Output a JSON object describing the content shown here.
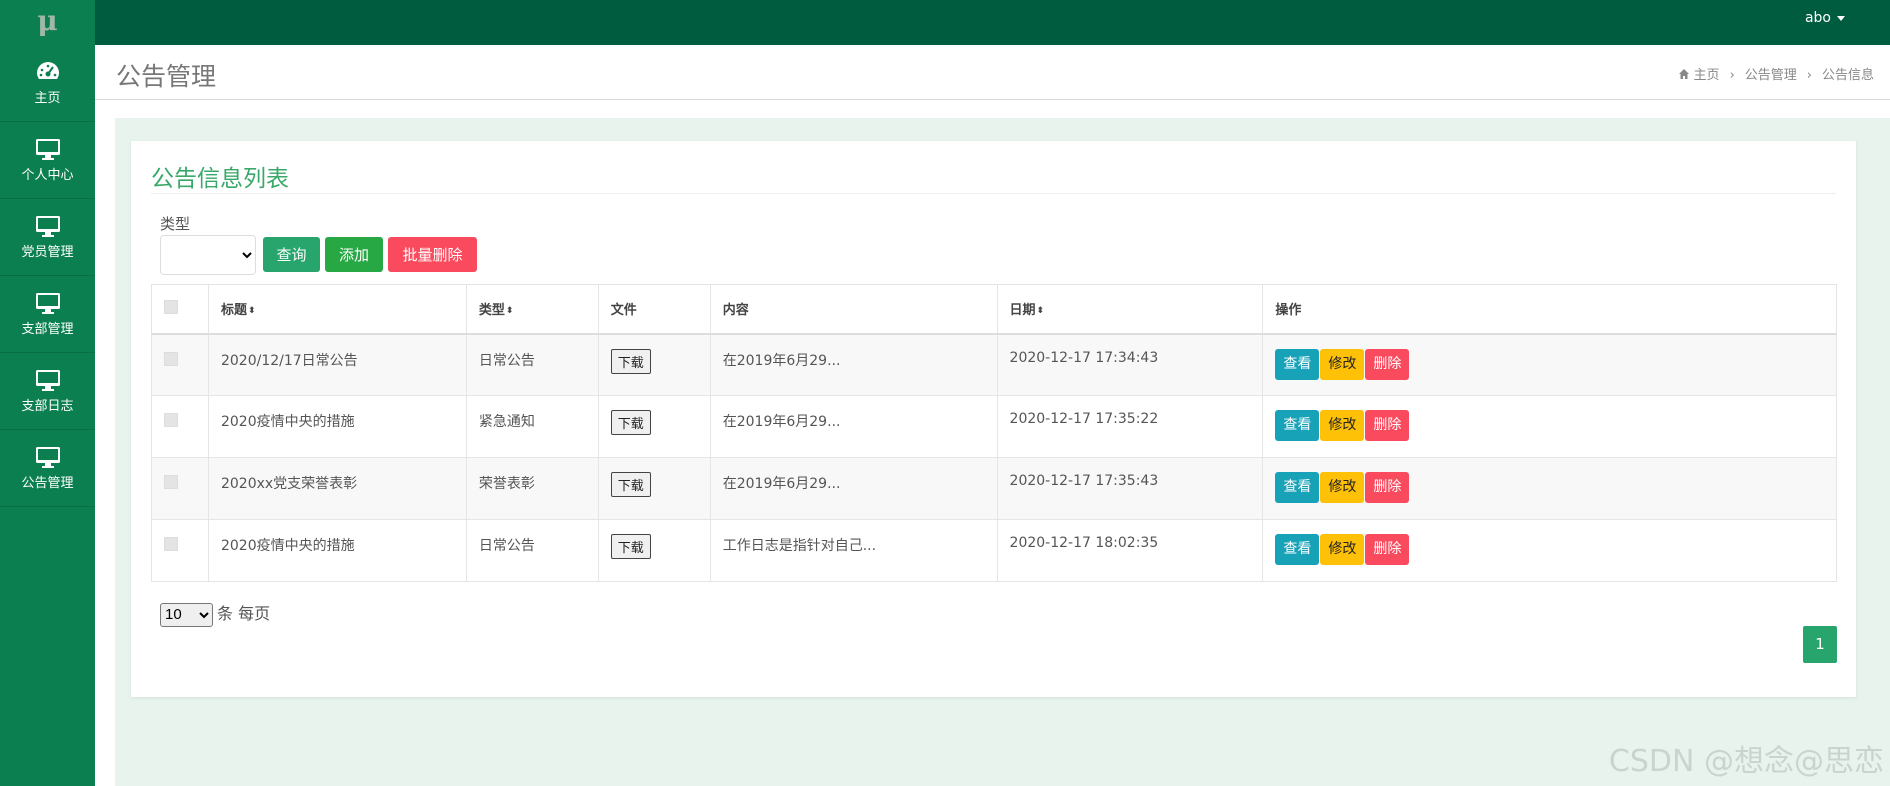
{
  "app": {
    "logo": "μ",
    "user": "abo"
  },
  "colors": {
    "sidebar": "#0b7f4f",
    "topbar": "#005c3e",
    "accent": "#28a46d",
    "danger": "#f94a5e",
    "warning": "#ffc107",
    "info": "#17a2b8"
  },
  "sidebar": {
    "items": [
      {
        "label": "主页",
        "icon": "dashboard-icon"
      },
      {
        "label": "个人中心",
        "icon": "monitor-icon"
      },
      {
        "label": "党员管理",
        "icon": "monitor-icon"
      },
      {
        "label": "支部管理",
        "icon": "monitor-icon"
      },
      {
        "label": "支部日志",
        "icon": "monitor-icon"
      },
      {
        "label": "公告管理",
        "icon": "monitor-icon"
      }
    ]
  },
  "header": {
    "title": "公告管理",
    "breadcrumb": [
      "主页",
      "公告管理",
      "公告信息"
    ]
  },
  "card": {
    "title": "公告信息列表",
    "filter_label": "类型",
    "query_label": "查询",
    "add_label": "添加",
    "bulk_delete_label": "批量删除"
  },
  "table": {
    "columns": [
      "标题",
      "类型",
      "文件",
      "内容",
      "日期",
      "操作"
    ],
    "rows": [
      {
        "title": "2020/12/17日常公告",
        "type": "日常公告",
        "file": "下载",
        "content": "在2019年6月29...",
        "date": "2020-12-17 17:34:43"
      },
      {
        "title": "2020疫情中央的措施",
        "type": "紧急通知",
        "file": "下载",
        "content": "在2019年6月29...",
        "date": "2020-12-17 17:35:22"
      },
      {
        "title": "2020xx党支荣誉表彰",
        "type": "荣誉表彰",
        "file": "下载",
        "content": "在2019年6月29...",
        "date": "2020-12-17 17:35:43"
      },
      {
        "title": "2020疫情中央的措施",
        "type": "日常公告",
        "file": "下载",
        "content": "工作日志是指针对自己...",
        "date": "2020-12-17 18:02:35"
      }
    ],
    "actions": {
      "view": "查看",
      "edit": "修改",
      "delete": "删除"
    }
  },
  "pager": {
    "page_size": "10",
    "unit_label": "条 每页",
    "current_page": "1"
  },
  "watermark": "CSDN @想念@思恋"
}
